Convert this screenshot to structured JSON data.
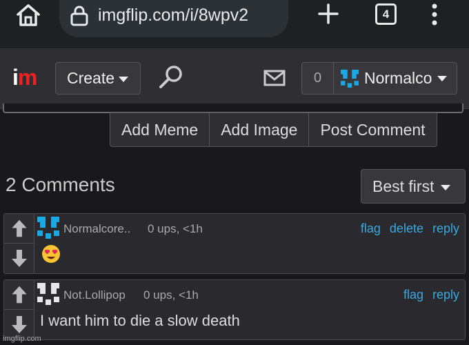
{
  "browser": {
    "url": "imgflip.com/i/8wpv2",
    "tab_count": "4"
  },
  "header": {
    "logo_i": "i",
    "logo_m": "m",
    "create_label": "Create",
    "notification_count": "0",
    "username": "Normalcore",
    "user_icon_color": "#1ba9e6"
  },
  "actions": {
    "add_meme": "Add Meme",
    "add_image": "Add Image",
    "post_comment": "Post Comment"
  },
  "comments_section": {
    "title": "2 Comments",
    "sort_label": "Best first"
  },
  "comments": [
    {
      "username": "Normalcore..",
      "meta": "0 ups, <1h",
      "links": [
        "flag",
        "delete",
        "reply"
      ],
      "text": "",
      "emoji": "smiling-face-with-heart-eyes",
      "avatar_color": "#1ba9e6"
    },
    {
      "username": "Not.Lollipop",
      "meta": "0 ups, <1h",
      "links": [
        "flag",
        "reply"
      ],
      "text": "I want him to die a slow death",
      "avatar_color": "#e6e6e6"
    }
  ],
  "watermark": "imgflip.com",
  "colors": {
    "link": "#3aa8e0",
    "logo_red": "#e22222"
  }
}
